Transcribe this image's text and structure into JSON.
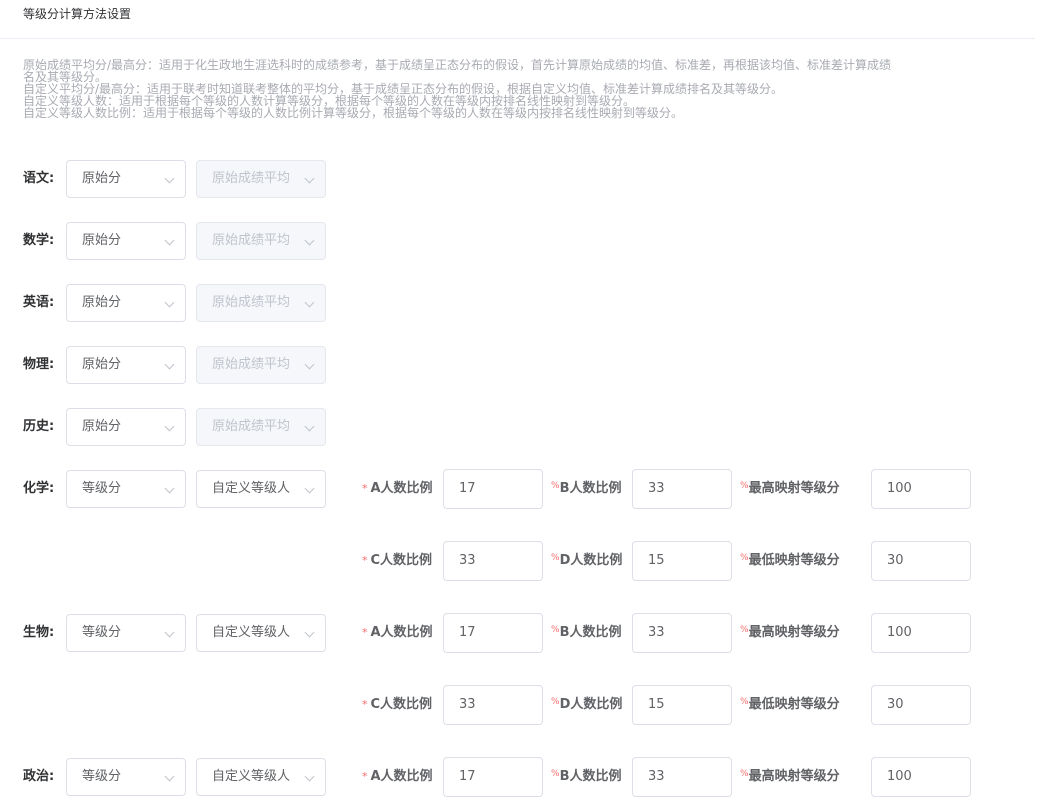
{
  "header": {
    "title": "等级分计算方法设置"
  },
  "description": [
    "原始成绩平均分/最高分：适用于化生政地生涯选科时的成绩参考，基于成绩呈正态分布的假设，首先计算原始成绩的均值、标准差，再根据该均值、标准差计算成绩",
    "名及其等级分。",
    "自定义平均分/最高分：适用于联考时知道联考整体的平均分，基于成绩呈正态分布的假设，根据自定义均值、标准差计算成绩排名及其等级分。",
    "自定义等级人数：适用于根据每个等级的人数计算等级分，根据每个等级的人数在等级内按排名线性映射到等级分。",
    "自定义等级人数比例：适用于根据每个等级的人数比例计算等级分，根据每个等级的人数在等级内按排名线性映射到等级分。"
  ],
  "simple_subjects": [
    {
      "label": "语文:",
      "method": "原始分",
      "sub": "原始成绩平均"
    },
    {
      "label": "数学:",
      "method": "原始分",
      "sub": "原始成绩平均"
    },
    {
      "label": "英语:",
      "method": "原始分",
      "sub": "原始成绩平均"
    },
    {
      "label": "物理:",
      "method": "原始分",
      "sub": "原始成绩平均"
    },
    {
      "label": "历史:",
      "method": "原始分",
      "sub": "原始成绩平均"
    }
  ],
  "labels": {
    "a_ratio": "A人数比例",
    "b_ratio": "B人数比例",
    "c_ratio": "C人数比例",
    "d_ratio": "D人数比例",
    "max_score": "最高映射等级分",
    "min_score": "最低映射等级分",
    "required_mark": "*",
    "percent": "%"
  },
  "graded_subjects": [
    {
      "label": "化学:",
      "method": "等级分",
      "sub": "自定义等级人",
      "a": "17",
      "b": "33",
      "max": "100",
      "c": "33",
      "d": "15",
      "min": "30"
    },
    {
      "label": "生物:",
      "method": "等级分",
      "sub": "自定义等级人",
      "a": "17",
      "b": "33",
      "max": "100",
      "c": "33",
      "d": "15",
      "min": "30"
    },
    {
      "label": "政治:",
      "method": "等级分",
      "sub": "自定义等级人",
      "a": "17",
      "b": "33",
      "max": "100"
    }
  ]
}
